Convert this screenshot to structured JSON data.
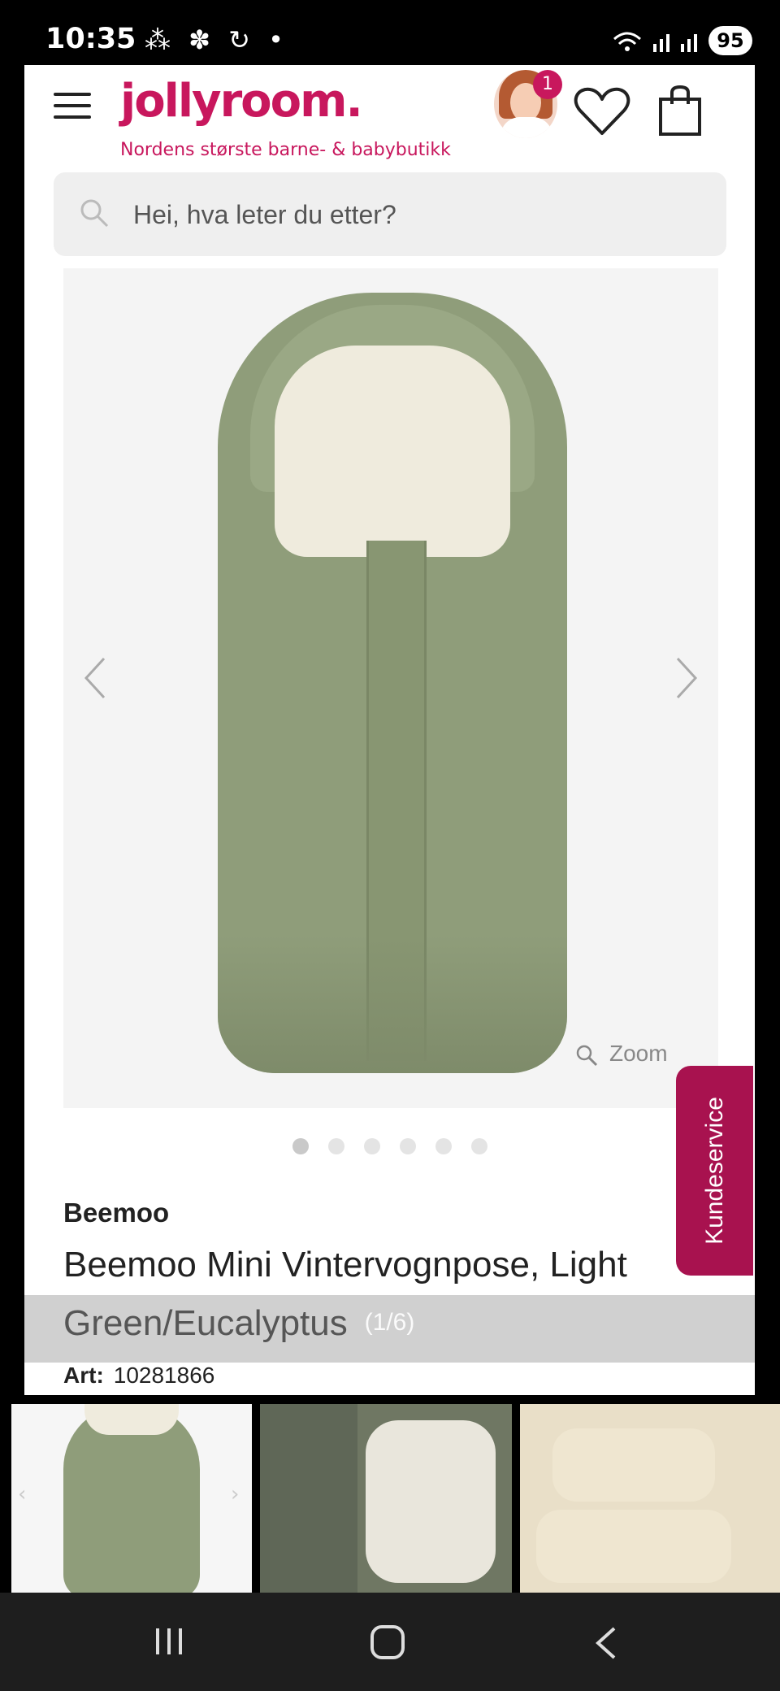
{
  "status_bar": {
    "time": "10:35",
    "left_icons": "⁂ ✽ ↻ •",
    "battery": "95"
  },
  "header": {
    "logo": "jollyroom.",
    "tagline": "Nordens største barne- & babybutikk",
    "notification_count": "1",
    "icons": [
      "menu-icon",
      "avatar",
      "heart-icon",
      "bag-icon"
    ]
  },
  "search": {
    "placeholder": "Hei, hva leter du etter?"
  },
  "gallery": {
    "zoom_label": "Zoom",
    "image_count": "(1/6)",
    "dots_total": 6,
    "active_dot": 1
  },
  "product": {
    "brand": "Beemoo",
    "title": "Beemoo Mini Vintervognpose, Light Green/Eucalyptus",
    "art_label": "Art:",
    "art_number": "10281866"
  },
  "side_tab": {
    "label": "Kundeservice"
  },
  "colors": {
    "brand_pink": "#c8175d",
    "side_tab": "#a8124f",
    "product_green": "#8f9d7a"
  }
}
